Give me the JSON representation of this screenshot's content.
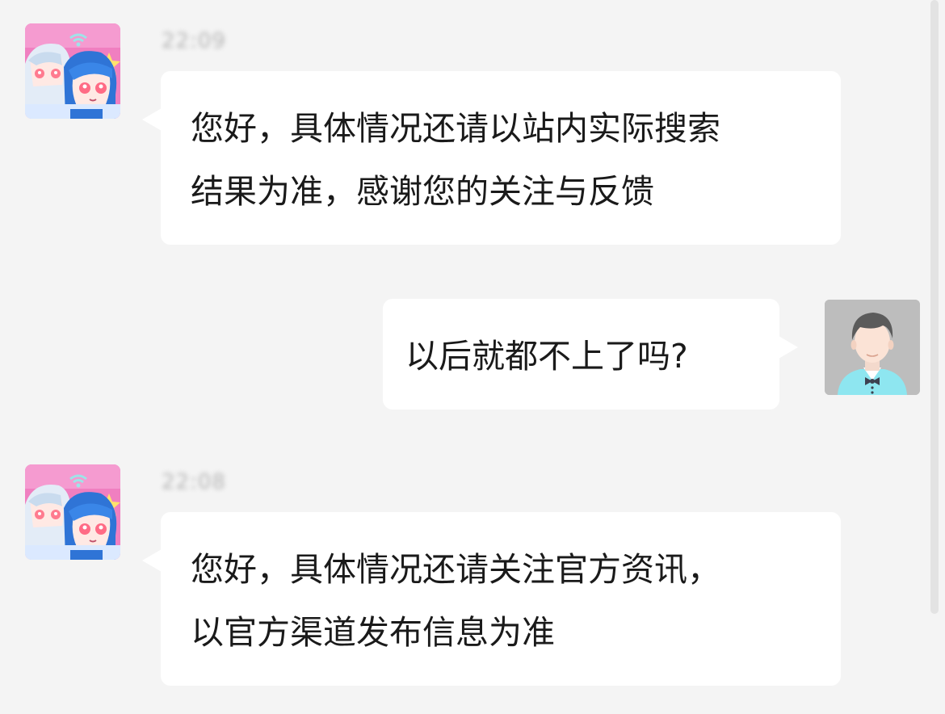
{
  "conversation": {
    "messages": [
      {
        "sender": "bot",
        "timestamp": "22:09",
        "text": "您好，具体情况还请以站内实际搜索\n结果为准，感谢您的关注与反馈"
      },
      {
        "sender": "user",
        "text": "以后就都不上了吗?"
      },
      {
        "sender": "bot",
        "timestamp": "22:08",
        "text": "您好，具体情况还请关注官方资讯，\n以官方渠道发布信息为准"
      }
    ]
  },
  "icons": {
    "bot_avatar": "anime-mascot-avatar-icon",
    "user_avatar": "default-user-avatar-icon",
    "wifi": "wifi-icon"
  },
  "colors": {
    "background": "#f4f4f4",
    "bubble": "#ffffff",
    "text": "#1a1a1a",
    "bot_avatar_bg": "#f07fc0",
    "user_avatar_bg": "#bdbdbd",
    "user_shirt": "#8ee6f0"
  }
}
